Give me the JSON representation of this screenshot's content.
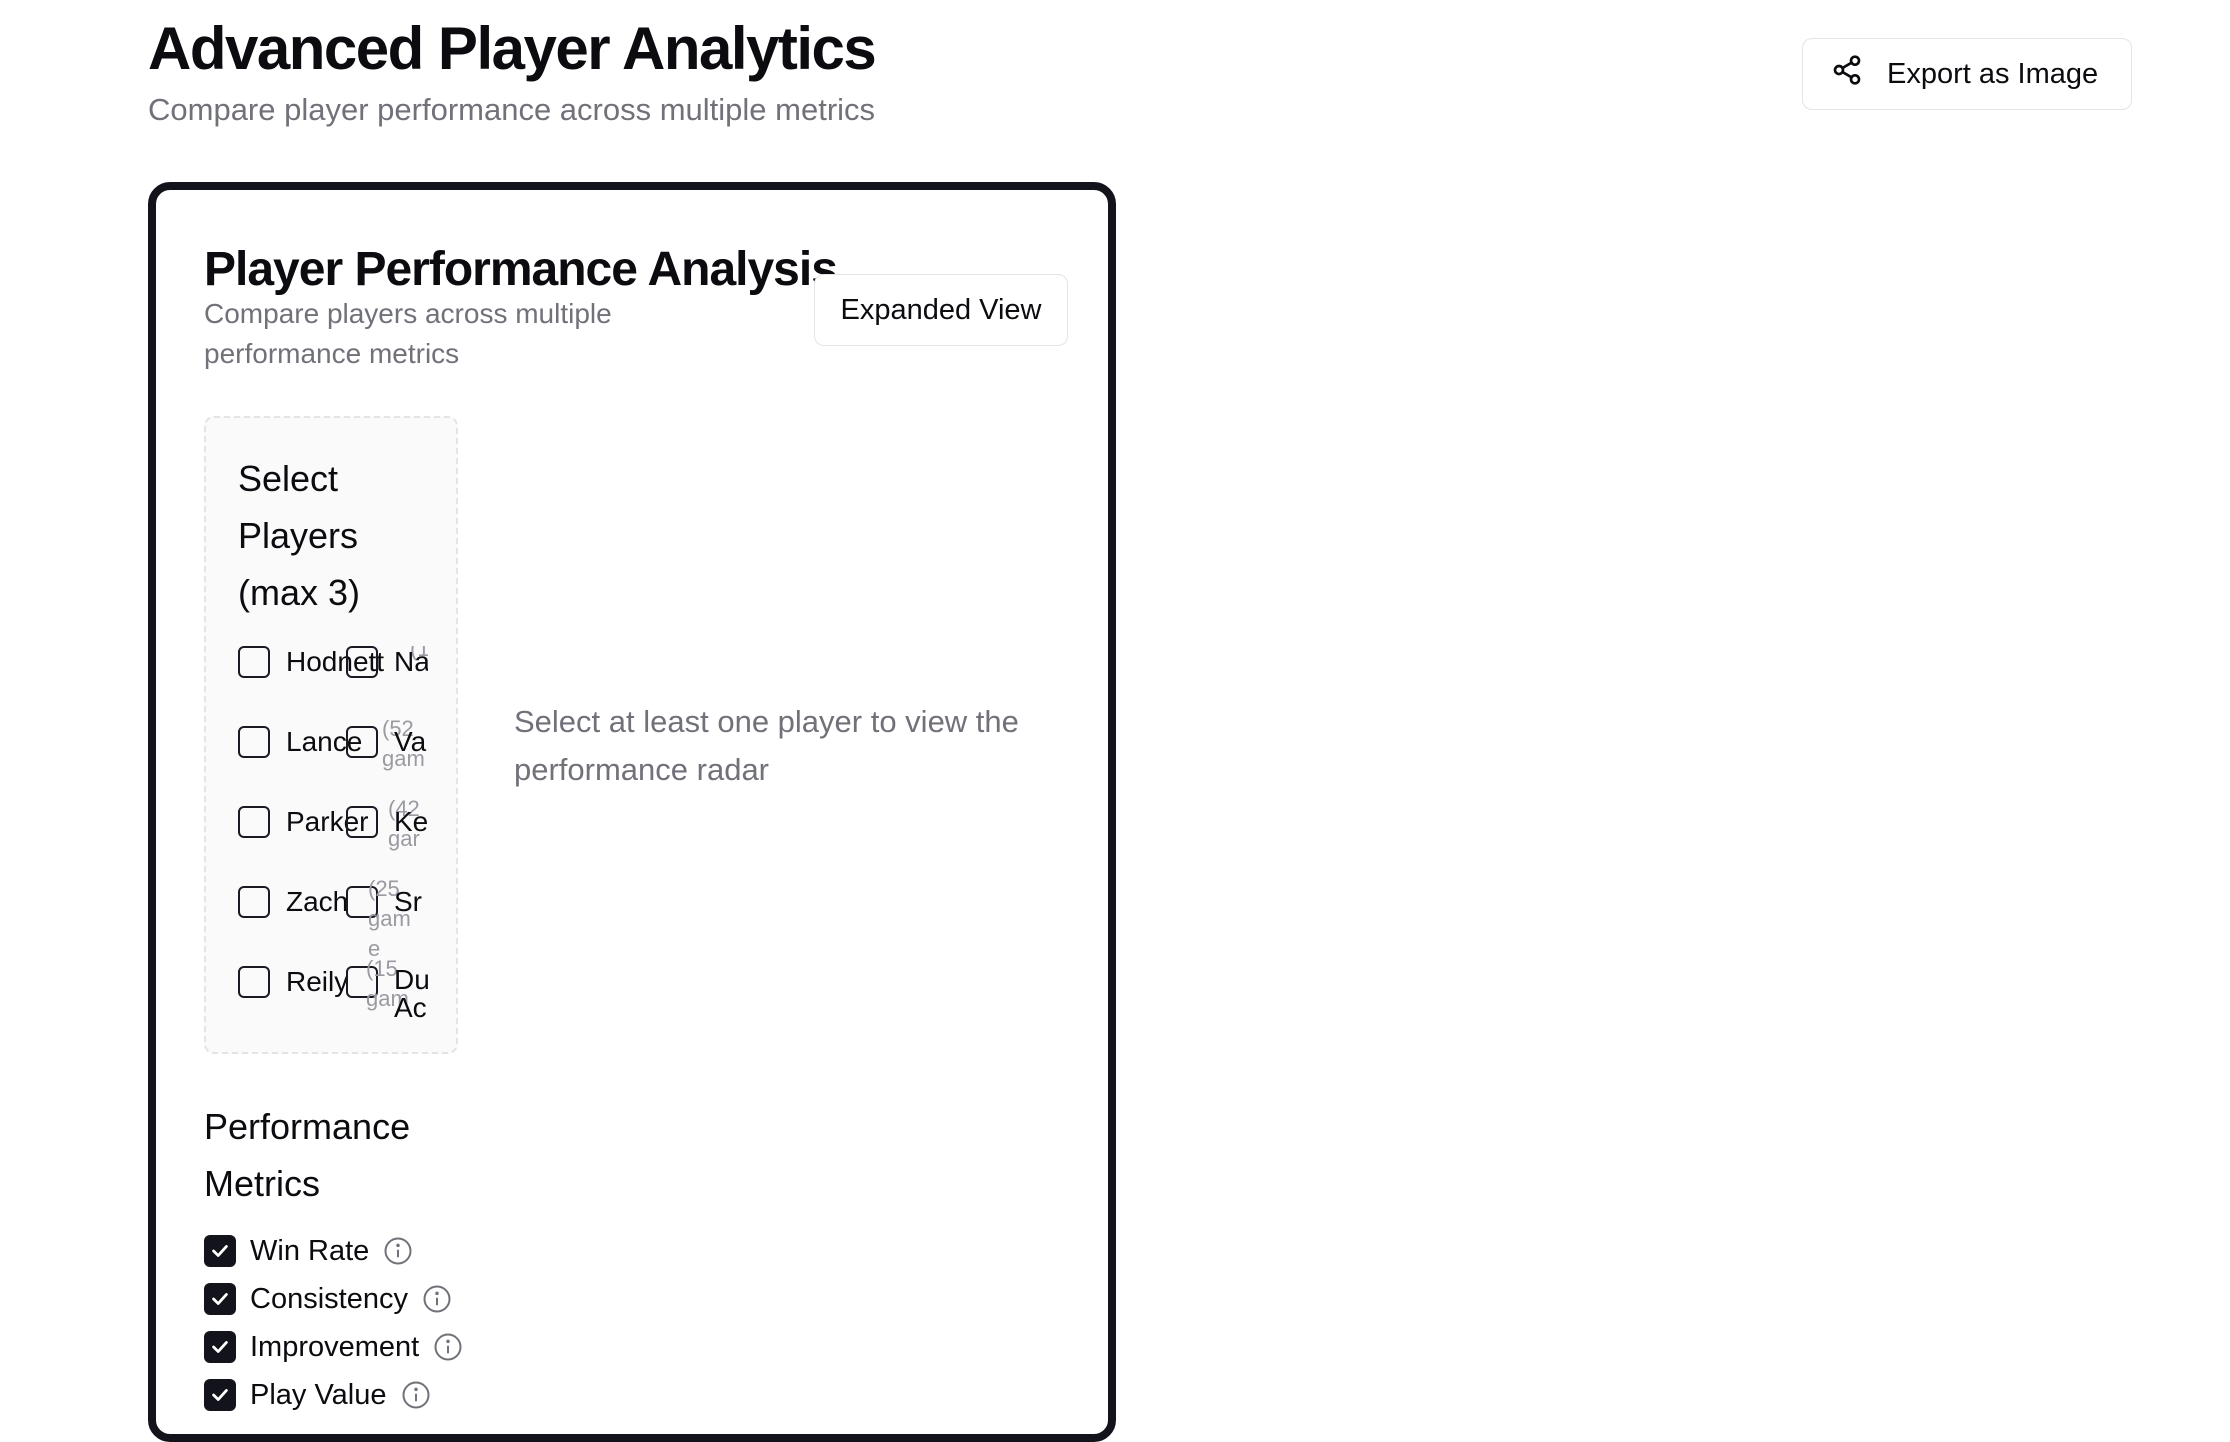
{
  "header": {
    "title": "Advanced Player Analytics",
    "subtitle": "Compare player performance across multiple metrics",
    "export_label": "Export as Image"
  },
  "card": {
    "title": "Player Performance Analysis",
    "description": "Compare players across multiple performance metrics",
    "expand_label": "Expanded View",
    "empty_message": "Select at least one player to view the performance radar"
  },
  "player_select": {
    "title": "Select Players (max 3)",
    "players": [
      {
        "name": "Hodnett",
        "games": "(1 g"
      },
      {
        "name": "Na",
        "games": ""
      },
      {
        "name": "Lance",
        "games": "(52 gam"
      },
      {
        "name": "Va",
        "games": ""
      },
      {
        "name": "Parker",
        "games": "(42 gar"
      },
      {
        "name": "Ke",
        "games": ""
      },
      {
        "name": "Zach",
        "games": "(25 game"
      },
      {
        "name": "Sr",
        "games": ""
      },
      {
        "name": "Reily",
        "games": "(15 gam"
      },
      {
        "name": "Du Ac",
        "games": ""
      }
    ]
  },
  "metrics": {
    "title": "Performance Metrics",
    "items": [
      {
        "label": "Win Rate",
        "checked": true
      },
      {
        "label": "Consistency",
        "checked": true
      },
      {
        "label": "Improvement",
        "checked": true
      },
      {
        "label": "Play Value",
        "checked": true
      }
    ]
  },
  "colors": {
    "primary": "#13131c",
    "muted_text": "#71717a",
    "border": "#e4e4e7"
  }
}
